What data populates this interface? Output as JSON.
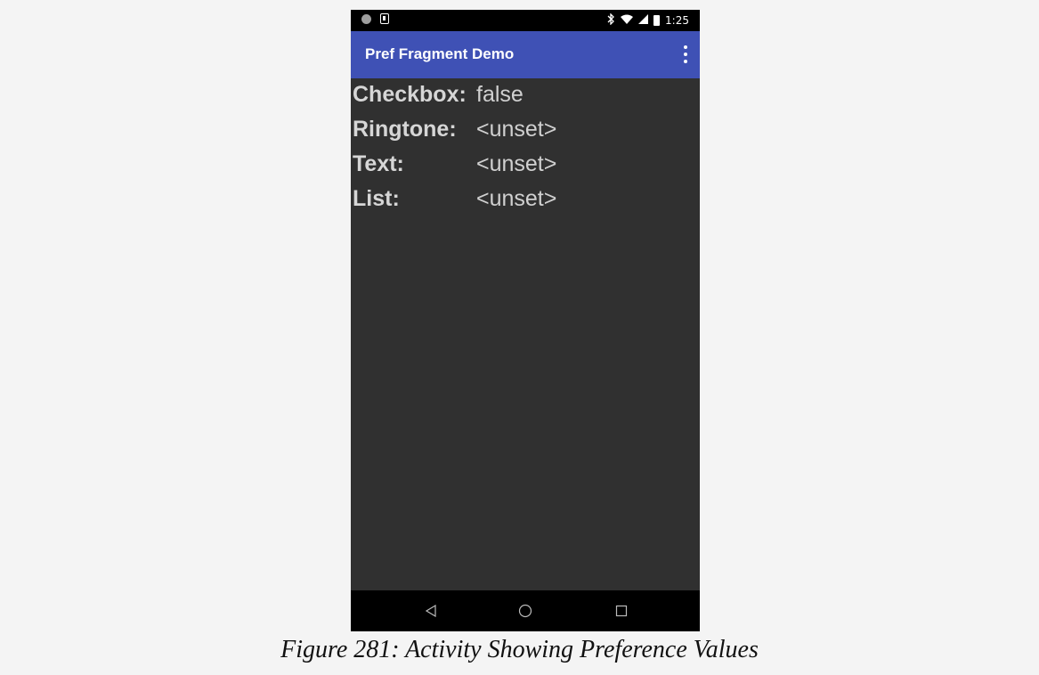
{
  "status_bar": {
    "time": "1:25",
    "icons": [
      "notification-dot-icon",
      "download-icon",
      "bluetooth-icon",
      "wifi-icon",
      "signal-icon",
      "battery-icon"
    ]
  },
  "toolbar": {
    "title": "Pref Fragment Demo",
    "overflow_icon": "overflow-menu-icon",
    "color": "#3f51b5"
  },
  "preferences": [
    {
      "label": "Checkbox:",
      "value": "false"
    },
    {
      "label": "Ringtone:",
      "value": "<unset>"
    },
    {
      "label": "Text:",
      "value": "<unset>"
    },
    {
      "label": "List:",
      "value": "<unset>"
    }
  ],
  "nav_bar": {
    "buttons": [
      "back-icon",
      "home-icon",
      "recents-icon"
    ]
  },
  "caption": "Figure 281: Activity Showing Preference Values"
}
